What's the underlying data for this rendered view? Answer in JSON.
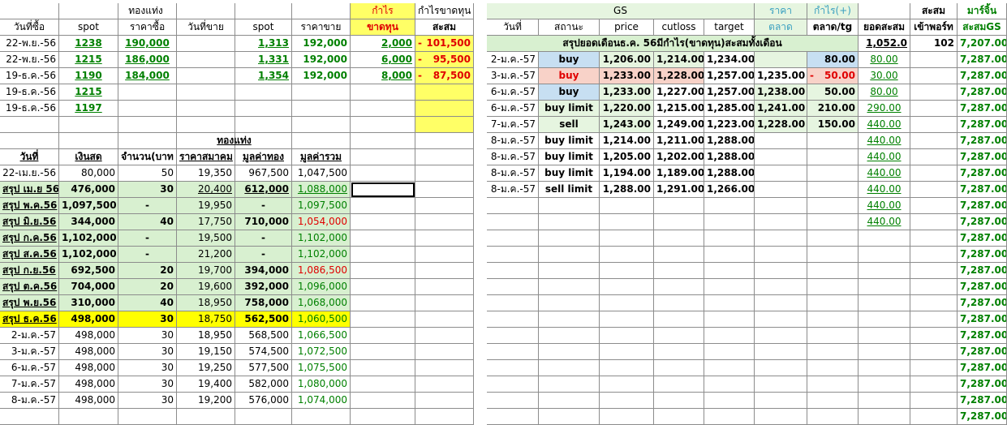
{
  "left": {
    "header1": {
      "group": "ทองแท่ง",
      "profit": "กำไร",
      "profitloss": "กำไรขาดทุน"
    },
    "header2": {
      "date_buy": "วันที่ซื้อ",
      "spot1": "spot",
      "price_buy": "ราคาซื้อ",
      "date_sell": "วันที่ขาย",
      "spot2": "spot",
      "price_sell": "ราคาขาย",
      "loss": "ขาดทุน",
      "accum": "สะสม"
    },
    "trades": [
      {
        "date": "22-พ.ย.-56",
        "spot": "1238",
        "buy": "190,000",
        "spot2": "1,313",
        "sell": "192,000",
        "pl": "2,000",
        "accum_sign": "-",
        "accum": "101,500"
      },
      {
        "date": "22-พ.ย.-56",
        "spot": "1215",
        "buy": "186,000",
        "spot2": "1,331",
        "sell": "192,000",
        "pl": "6,000",
        "accum_sign": "-",
        "accum": "95,500"
      },
      {
        "date": "19-ธ.ค.-56",
        "spot": "1190",
        "buy": "184,000",
        "spot2": "1,354",
        "sell": "192,000",
        "pl": "8,000",
        "accum_sign": "-",
        "accum": "87,500"
      },
      {
        "date": "19-ธ.ค.-56",
        "spot": "1215",
        "buy": "",
        "spot2": "",
        "sell": "",
        "pl": "",
        "accum_sign": "",
        "accum": ""
      },
      {
        "date": "19-ธ.ค.-56",
        "spot": "1197",
        "buy": "",
        "spot2": "",
        "sell": "",
        "pl": "",
        "accum_sign": "",
        "accum": ""
      }
    ],
    "summary_header": {
      "group": "ทองแท่ง",
      "date": "วันที่",
      "cash": "เงินสด",
      "qty": "จำนวน(บาท",
      "assoc": "ราคาสมาคม",
      "gold_value": "มูลค่าทอง",
      "total": "มูลค่ารวม"
    },
    "summary": [
      {
        "date": "22-เม.ย.-56",
        "cash": "80,000",
        "qty": "50",
        "assoc": "19,350",
        "gold": "967,500",
        "total": "1,047,500",
        "style": "plain",
        "total_color": "black"
      },
      {
        "date": "สรุป เม.ย 56",
        "cash": "476,000",
        "qty": "30",
        "assoc": "20,400",
        "gold": "612,000",
        "total": "1,088,000",
        "style": "green",
        "total_color": "green"
      },
      {
        "date": "สรุป พ.ค.56",
        "cash": "1,097,500",
        "qty": "-",
        "assoc": "19,950",
        "gold": "-",
        "total": "1,097,500",
        "style": "green",
        "total_color": "green"
      },
      {
        "date": "สรุป มิ.ย.56",
        "cash": "344,000",
        "qty": "40",
        "assoc": "17,750",
        "gold": "710,000",
        "total": "1,054,000",
        "style": "green",
        "total_color": "red"
      },
      {
        "date": "สรุป ก.ค.56",
        "cash": "1,102,000",
        "qty": "-",
        "assoc": "19,500",
        "gold": "-",
        "total": "1,102,000",
        "style": "green",
        "total_color": "green"
      },
      {
        "date": "สรุป ส.ค.56",
        "cash": "1,102,000",
        "qty": "-",
        "assoc": "21,200",
        "gold": "-",
        "total": "1,102,000",
        "style": "green",
        "total_color": "green"
      },
      {
        "date": "สรุป ก.ย.56",
        "cash": "692,500",
        "qty": "20",
        "assoc": "19,700",
        "gold": "394,000",
        "total": "1,086,500",
        "style": "green",
        "total_color": "red"
      },
      {
        "date": "สรุป ต.ค.56",
        "cash": "704,000",
        "qty": "20",
        "assoc": "19,600",
        "gold": "392,000",
        "total": "1,096,000",
        "style": "green",
        "total_color": "green"
      },
      {
        "date": "สรุป พ.ย.56",
        "cash": "310,000",
        "qty": "40",
        "assoc": "18,950",
        "gold": "758,000",
        "total": "1,068,000",
        "style": "green",
        "total_color": "green"
      },
      {
        "date": "สรุป ธ.ค.56",
        "cash": "498,000",
        "qty": "30",
        "assoc": "18,750",
        "gold": "562,500",
        "total": "1,060,500",
        "style": "yellow",
        "total_color": "green"
      },
      {
        "date": "2-ม.ค.-57",
        "cash": "498,000",
        "qty": "30",
        "assoc": "18,950",
        "gold": "568,500",
        "total": "1,066,500",
        "style": "plain",
        "total_color": "green"
      },
      {
        "date": "3-ม.ค.-57",
        "cash": "498,000",
        "qty": "30",
        "assoc": "19,150",
        "gold": "574,500",
        "total": "1,072,500",
        "style": "plain",
        "total_color": "green"
      },
      {
        "date": "6-ม.ค.-57",
        "cash": "498,000",
        "qty": "30",
        "assoc": "19,250",
        "gold": "577,500",
        "total": "1,075,500",
        "style": "plain",
        "total_color": "green"
      },
      {
        "date": "7-ม.ค.-57",
        "cash": "498,000",
        "qty": "30",
        "assoc": "19,400",
        "gold": "582,000",
        "total": "1,080,000",
        "style": "plain",
        "total_color": "green"
      },
      {
        "date": "8-ม.ค.-57",
        "cash": "498,000",
        "qty": "30",
        "assoc": "19,200",
        "gold": "576,000",
        "total": "1,074,000",
        "style": "plain",
        "total_color": "green"
      }
    ]
  },
  "right": {
    "header1": {
      "gs": "GS",
      "price": "ราคา",
      "profit": "กำไร(+)",
      "accum": "สะสม",
      "margin": "มาร์จิ้น"
    },
    "header2": {
      "date": "วันที่",
      "status": "สถานะ",
      "price": "price",
      "cutloss": "cutloss",
      "target": "target",
      "market": "ตลาด",
      "market_tg": "ตลาด/tg",
      "total_accum": "ยอดสะสม",
      "port": "เข้าพอร์ท",
      "accum_gs": "สะสมGS"
    },
    "summary_row": {
      "label": "สรุปยอดเดือนธ.ค. 56มีกำไร(ขาดทุน)สะสมทั้งเดือน",
      "total": "1,052.0",
      "port": "102",
      "margin": "7,207.00"
    },
    "rows": [
      {
        "date": "2-ม.ค.-57",
        "status": "buy",
        "price": "1,206.00",
        "cutloss": "1,214.00",
        "target": "1,234.00",
        "market": "",
        "pl_sign": "",
        "pl": "80.00",
        "accum": "80.00",
        "margin": "7,287.00",
        "status_style": "buy",
        "price_style": "green",
        "cut_style": "green",
        "mkt_style": "lgreen",
        "pl_style": "blue"
      },
      {
        "date": "3-ม.ค.-57",
        "status": "buy",
        "price": "1,233.00",
        "cutloss": "1,228.00",
        "target": "1,257.00",
        "market": "1,235.00",
        "pl_sign": "-",
        "pl": "50.00",
        "accum": "30.00",
        "margin": "7,287.00",
        "status_style": "buyred",
        "price_style": "red",
        "cut_style": "red",
        "mkt_style": "plain",
        "pl_style": "pink"
      },
      {
        "date": "6-ม.ค.-57",
        "status": "buy",
        "price": "1,233.00",
        "cutloss": "1,227.00",
        "target": "1,257.00",
        "market": "1,238.00",
        "pl_sign": "",
        "pl": "50.00",
        "accum": "80.00",
        "margin": "7,287.00",
        "status_style": "buy",
        "price_style": "green",
        "cut_style": "plain",
        "mkt_style": "green",
        "pl_style": "green"
      },
      {
        "date": "6-ม.ค.-57",
        "status": "buy limit",
        "price": "1,220.00",
        "cutloss": "1,215.00",
        "target": "1,285.00",
        "market": "1,241.00",
        "pl_sign": "",
        "pl": "210.00",
        "accum": "290.00",
        "margin": "7,287.00",
        "status_style": "limit",
        "price_style": "green",
        "cut_style": "plain",
        "mkt_style": "green",
        "pl_style": "green"
      },
      {
        "date": "7-ม.ค.-57",
        "status": "sell",
        "price": "1,243.00",
        "cutloss": "1,249.00",
        "target": "1,223.00",
        "market": "1,228.00",
        "pl_sign": "",
        "pl": "150.00",
        "accum": "440.00",
        "margin": "7,287.00",
        "status_style": "sell",
        "price_style": "green",
        "cut_style": "plain",
        "mkt_style": "green",
        "pl_style": "green"
      },
      {
        "date": "8-ม.ค.-57",
        "status": "buy limit",
        "price": "1,214.00",
        "cutloss": "1,211.00",
        "target": "1,288.00",
        "market": "",
        "pl_sign": "",
        "pl": "",
        "accum": "440.00",
        "margin": "7,287.00",
        "status_style": "plainb",
        "price_style": "plain",
        "cut_style": "plain",
        "mkt_style": "plain",
        "pl_style": "plain"
      },
      {
        "date": "8-ม.ค.-57",
        "status": "buy limit",
        "price": "1,205.00",
        "cutloss": "1,202.00",
        "target": "1,288.00",
        "market": "",
        "pl_sign": "",
        "pl": "",
        "accum": "440.00",
        "margin": "7,287.00",
        "status_style": "plainb",
        "price_style": "plain",
        "cut_style": "plain",
        "mkt_style": "plain",
        "pl_style": "plain"
      },
      {
        "date": "8-ม.ค.-57",
        "status": "buy limit",
        "price": "1,194.00",
        "cutloss": "1,189.00",
        "target": "1,288.00",
        "market": "",
        "pl_sign": "",
        "pl": "",
        "accum": "440.00",
        "margin": "7,287.00",
        "status_style": "plainb",
        "price_style": "plain",
        "cut_style": "plain",
        "mkt_style": "plain",
        "pl_style": "plain"
      },
      {
        "date": "8-ม.ค.-57",
        "status": "sell limit",
        "price": "1,288.00",
        "cutloss": "1,291.00",
        "target": "1,266.00",
        "market": "",
        "pl_sign": "",
        "pl": "",
        "accum": "440.00",
        "margin": "7,287.00",
        "status_style": "plainb",
        "price_style": "plain",
        "cut_style": "plain",
        "mkt_style": "plain",
        "pl_style": "plain"
      }
    ],
    "extra_accum": [
      "440.00",
      "440.00"
    ],
    "extra_margin": [
      "7,287.00",
      "7,287.00",
      "7,287.00",
      "7,287.00",
      "7,287.00",
      "7,287.00",
      "7,287.00",
      "7,287.00",
      "7,287.00",
      "7,287.00",
      "7,287.00",
      "7,287.00",
      "7,287.00",
      "7,287.00"
    ]
  }
}
